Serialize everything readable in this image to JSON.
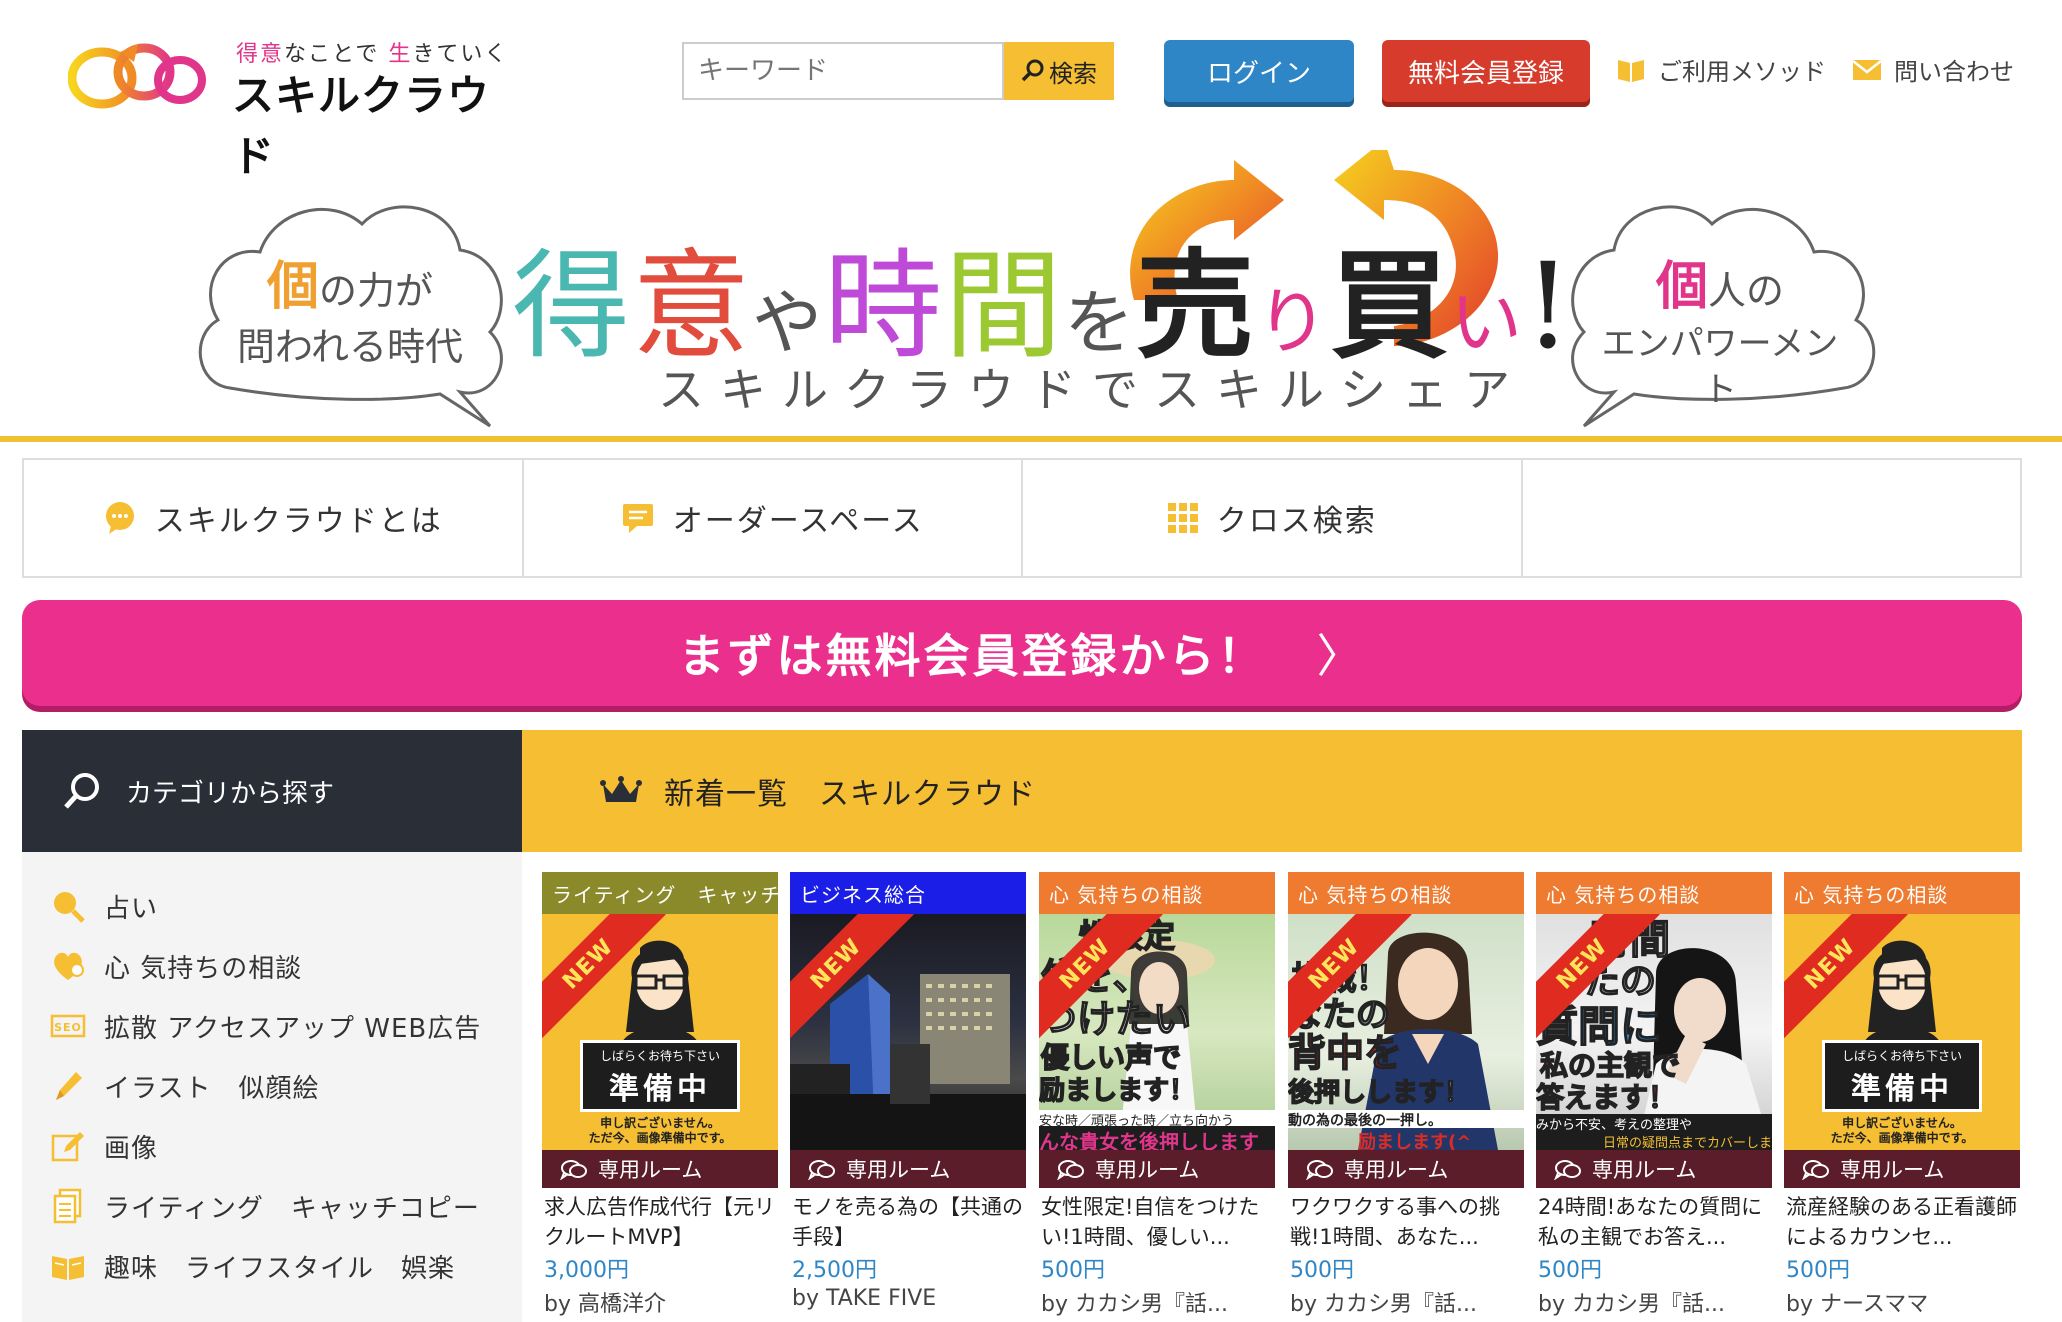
{
  "header": {
    "logo_tagline_parts": [
      "得意",
      "なことで",
      "生",
      "きていく"
    ],
    "logo_name": "スキルクラウド",
    "search": {
      "placeholder": "キーワード",
      "button_label": "検索"
    },
    "login_label": "ログイン",
    "register_label": "無料会員登録",
    "links": [
      {
        "label": "ご利用メソッド",
        "icon": "book-icon"
      },
      {
        "label": "問い合わせ",
        "icon": "mail-icon"
      }
    ]
  },
  "hero": {
    "left_cloud": {
      "accent": "個",
      "line1": "の力が",
      "line2": "問われる時代"
    },
    "title_parts": [
      {
        "text": "得",
        "color": "#4ab8b0"
      },
      {
        "text": "意",
        "color": "#e24c3c"
      },
      {
        "text": "や",
        "color": "#555555"
      },
      {
        "text": "時",
        "color": "#c04ad8"
      },
      {
        "text": "間",
        "color": "#9cc832"
      },
      {
        "text": "を",
        "color": "#555555"
      },
      {
        "text": "売",
        "color": "#222222"
      },
      {
        "text": "り",
        "color": "#e0358a"
      },
      {
        "text": "買",
        "color": "#222222"
      },
      {
        "text": "い",
        "color": "#e0358a"
      },
      {
        "text": "!",
        "color": "#222222"
      }
    ],
    "subtitle": "スキルクラウドでスキルシェア",
    "right_cloud": {
      "accent": "個",
      "line1": "人の",
      "line2": "エンパワーメント"
    }
  },
  "nav": [
    {
      "label": "スキルクラウドとは",
      "icon": "chat-bubble-icon"
    },
    {
      "label": "オーダースペース",
      "icon": "message-icon"
    },
    {
      "label": "クロス検索",
      "icon": "grid-icon"
    },
    {
      "label": "",
      "icon": ""
    }
  ],
  "cta": {
    "label": "まずは無料会員登録から！",
    "chevron": "〉"
  },
  "sidebar": {
    "title": "カテゴリから探す",
    "categories": [
      {
        "label": "占い",
        "icon": "search-icon"
      },
      {
        "label": "心 気持ちの相談",
        "icon": "heart-icon"
      },
      {
        "label": "拡散 アクセスアップ WEB広告",
        "icon": "seo-icon"
      },
      {
        "label": "イラスト　似顔絵",
        "icon": "pen-icon"
      },
      {
        "label": "画像",
        "icon": "edit-image-icon"
      },
      {
        "label": "ライティング　キャッチコピー",
        "icon": "document-icon"
      },
      {
        "label": "趣味　ライフスタイル　娯楽",
        "icon": "open-book-icon"
      }
    ]
  },
  "new_section": {
    "title": "新着一覧　スキルクラウド"
  },
  "cards": [
    {
      "category": "ライティング　キャッチ",
      "cat_color": "#8a8a2a",
      "image": "preparing",
      "ribbon": "NEW",
      "room": "専用ルーム",
      "title": "求人広告作成代行【元リクルートMVP】",
      "price": "3,000円",
      "by": "by 高橋洋介",
      "img_text": {
        "top": "しばらくお待ち下さい",
        "main": "準備中",
        "sub1": "申し訳ございません。",
        "sub2": "ただ今、画像準備中です。"
      }
    },
    {
      "category": "ビジネス総合",
      "cat_color": "#1a1ee6",
      "image": "city-night",
      "ribbon": "NEW",
      "room": "専用ルーム",
      "title": "モノを売る為の【共通の手段】",
      "price": "2,500円",
      "by": "by TAKE FIVE"
    },
    {
      "category": "心 気持ちの相談",
      "cat_color": "#ee7b30",
      "image": "photo-woman-hat",
      "ribbon": "NEW",
      "room": "専用ルーム",
      "title": "女性限定!自信をつけたい!1時間、優しい...",
      "price": "500円",
      "by": "by カカシ男『話...",
      "img_text": {
        "l1": "性限定",
        "l2": "信を、",
        "l3": "つけたい",
        "l4": "優しい声で",
        "l5": "励まします！",
        "l6": "安な時／頑張った時／立ち向かう",
        "l7": "んな貴女を後押しします"
      }
    },
    {
      "category": "心 気持ちの相談",
      "cat_color": "#ee7b30",
      "image": "photo-woman",
      "ribbon": "NEW",
      "room": "専用ルーム",
      "title": "ワクワクする事への挑戦!1時間、あなた...",
      "price": "500円",
      "by": "by カカシ男『話...",
      "img_text": {
        "l1": "ク",
        "l2": "挑戦！",
        "l3": "なたの",
        "l4": "背中を",
        "l5": "後押しします！",
        "l6": "動の為の最後の一押し。",
        "l7": "励まします(^"
      }
    },
    {
      "category": "心 気持ちの相談",
      "cat_color": "#ee7b30",
      "image": "photo-woman-sad",
      "ribbon": "NEW",
      "room": "専用ルーム",
      "title": "24時間!あなたの質問に私の主観でお答え...",
      "price": "500円",
      "by": "by カカシ男『話...",
      "img_text": {
        "l1": "時間",
        "l2": "なたの",
        "l3": "質問に",
        "l4": "私の主観で",
        "l5": "答えます！",
        "l6": "みから不安、考えの整理や",
        "l7": "日常の疑問点までカバーしま"
      }
    },
    {
      "category": "心 気持ちの相談",
      "cat_color": "#ee7b30",
      "image": "preparing",
      "ribbon": "NEW",
      "room": "専用ルーム",
      "title": "流産経験のある正看護師によるカウンセ...",
      "price": "500円",
      "by": "by ナースママ",
      "img_text": {
        "top": "しばらくお待ち下さい",
        "main": "準備中",
        "sub1": "申し訳ございません。",
        "sub2": "ただ今、画像準備中です。"
      }
    }
  ],
  "colors": {
    "accent_yellow": "#f5be33",
    "pink": "#ea2f8c",
    "blue": "#2f86c6",
    "red": "#d63b2c",
    "dark": "#2a2e37",
    "room": "#5a1d29"
  }
}
